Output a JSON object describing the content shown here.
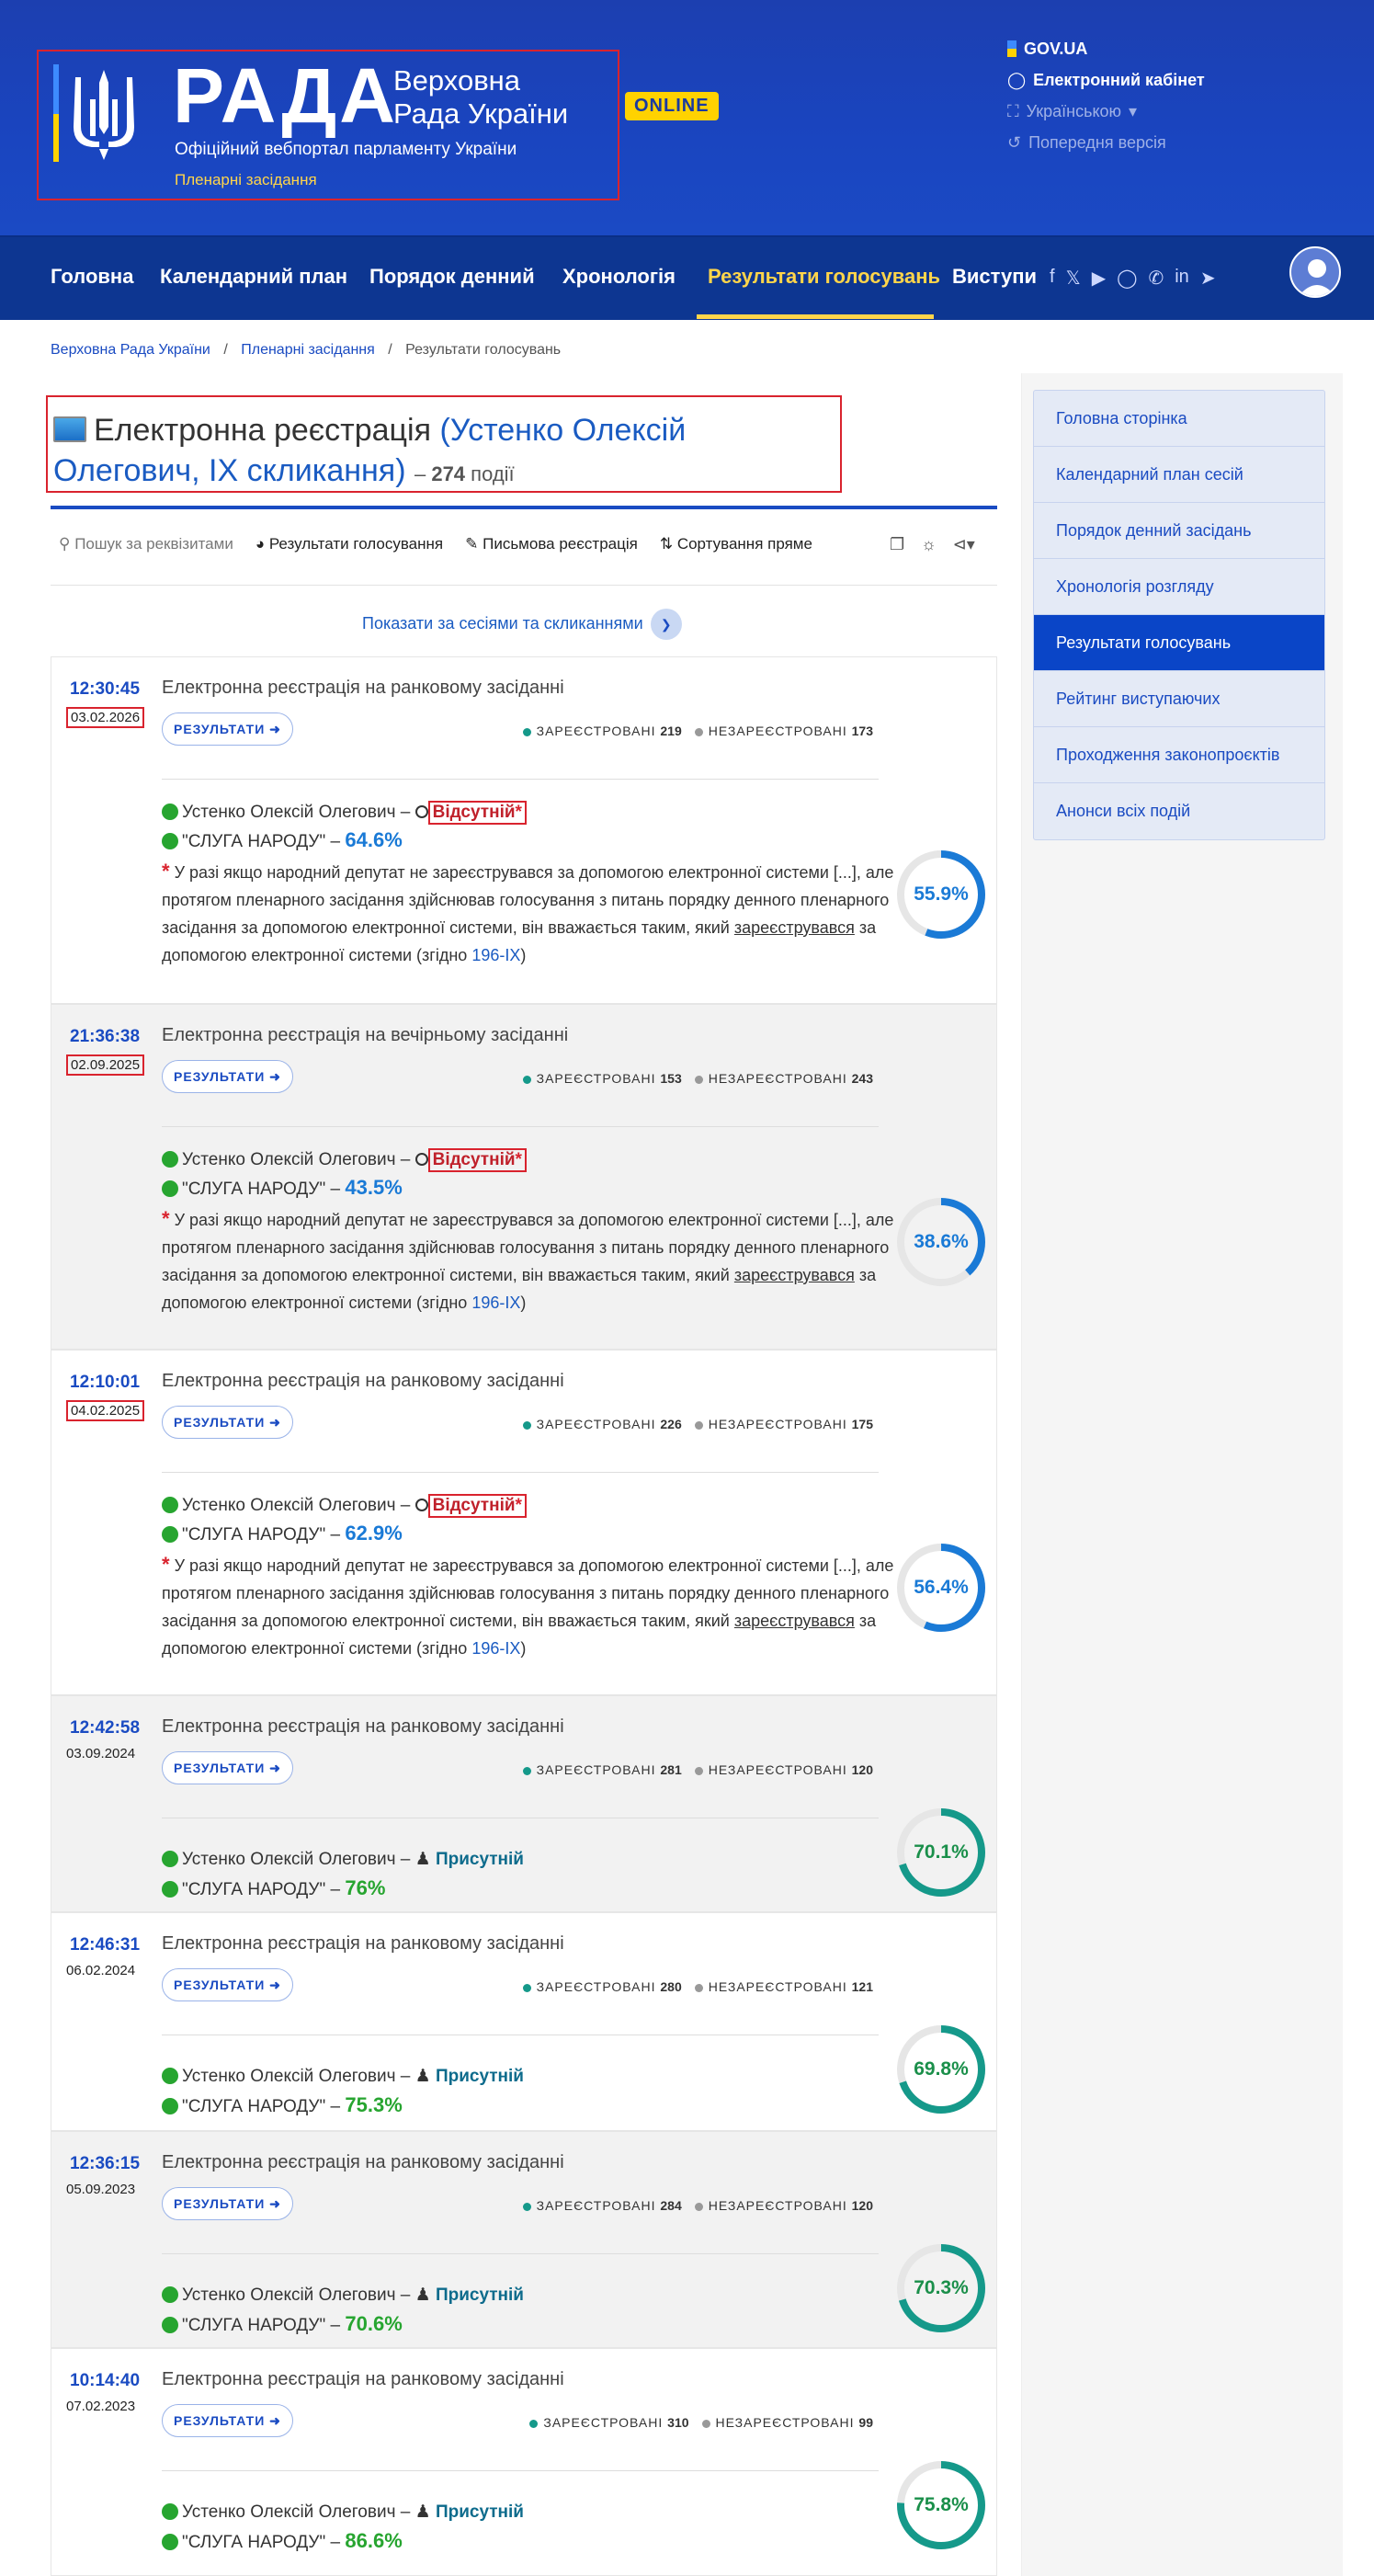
{
  "header": {
    "logo_text": "РАДА",
    "logo_sub_line1": "Верховна",
    "logo_sub_line2": "Рада України",
    "online_badge": "ONLINE",
    "official": "Офіційний вебпортал парламенту України",
    "section": "Пленарні засідання",
    "links": {
      "gov": "GOV.UA",
      "cabinet": "Електронний кабінет",
      "lang": "Українською",
      "prev": "Попередня версія"
    }
  },
  "nav": {
    "items": [
      "Головна",
      "Календарний план",
      "Порядок денний",
      "Хронологія",
      "Результати голосувань",
      "Виступи"
    ],
    "active_index": 4
  },
  "breadcrumb": [
    "Верховна Рада України",
    "Пленарні засідання",
    "Результати голосувань"
  ],
  "page": {
    "title": "Електронна реєстрація",
    "name": "(Устенко Олексій Олегович, IX скликання)",
    "count": "274",
    "count_suffix": "події"
  },
  "toolbar": {
    "search": "Пошук за реквізитами",
    "results": "Результати голосування",
    "written": "Письмова реєстрація",
    "sort": "Сортування пряме"
  },
  "show_sessions": "Показати за сесіями та скликаннями",
  "labels": {
    "results_button": "РЕЗУЛЬТАТИ",
    "registered": "ЗАРЕЄСТРОВАНІ",
    "unregistered": "НЕЗАРЕЄСТРОВАНІ",
    "person": "Устенко Олексій Олегович",
    "absent": "Відсутній",
    "present": "Присутній",
    "party": "\"СЛУГА НАРОДУ\"",
    "note_part1": "У разі якщо народний депутат не зареєструвався за допомогою електронної системи [...], але протягом пленарного засідання здійснював голосування з питань порядку денного пленарного засідання за допомогою електронної системи, він вважається таким, який",
    "note_underlined": "зареєструвався",
    "note_part2": "за допомогою електронної системи (згідно",
    "note_link": "196-IX",
    "note_end": ")"
  },
  "events": [
    {
      "time": "12:30:45",
      "date": "03.02.2026",
      "title": "Електронна реєстрація на ранковому засіданні",
      "registered": "219",
      "unregistered": "173",
      "status": "absent",
      "party_pct": "64.6%",
      "gauge": 55.9,
      "gauge_label": "55.9%"
    },
    {
      "time": "21:36:38",
      "date": "02.09.2025",
      "title": "Електронна реєстрація на вечірньому засіданні",
      "registered": "153",
      "unregistered": "243",
      "status": "absent",
      "party_pct": "43.5%",
      "gauge": 38.6,
      "gauge_label": "38.6%"
    },
    {
      "time": "12:10:01",
      "date": "04.02.2025",
      "title": "Електронна реєстрація на ранковому засіданні",
      "registered": "226",
      "unregistered": "175",
      "status": "absent",
      "party_pct": "62.9%",
      "gauge": 56.4,
      "gauge_label": "56.4%"
    },
    {
      "time": "12:42:58",
      "date": "03.09.2024",
      "title": "Електронна реєстрація на ранковому засіданні",
      "registered": "281",
      "unregistered": "120",
      "status": "present",
      "party_pct": "76%",
      "gauge": 70.1,
      "gauge_label": "70.1%"
    },
    {
      "time": "12:46:31",
      "date": "06.02.2024",
      "title": "Електронна реєстрація на ранковому засіданні",
      "registered": "280",
      "unregistered": "121",
      "status": "present",
      "party_pct": "75.3%",
      "gauge": 69.8,
      "gauge_label": "69.8%"
    },
    {
      "time": "12:36:15",
      "date": "05.09.2023",
      "title": "Електронна реєстрація на ранковому засіданні",
      "registered": "284",
      "unregistered": "120",
      "status": "present",
      "party_pct": "70.6%",
      "gauge": 70.3,
      "gauge_label": "70.3%"
    },
    {
      "time": "10:14:40",
      "date": "07.02.2023",
      "title": "Електронна реєстрація на ранковому засіданні",
      "registered": "310",
      "unregistered": "99",
      "status": "present",
      "party_pct": "86.6%",
      "gauge": 75.8,
      "gauge_label": "75.8%"
    }
  ],
  "sidebar": {
    "items": [
      "Головна сторінка",
      "Календарний план сесій",
      "Порядок денний засідань",
      "Хронологія розгляду",
      "Результати голосувань",
      "Рейтинг виступаючих",
      "Проходження законопроєктів",
      "Анонси всіх подій"
    ],
    "active_index": 4
  },
  "colors": {
    "header_bg": "#1c3fb0",
    "nav_bg": "#0d3691",
    "accent_yellow": "#ffd54a",
    "gauge_blue": "#1a7ad6",
    "gauge_teal": "#15998a",
    "absent_red": "#d9232e"
  }
}
